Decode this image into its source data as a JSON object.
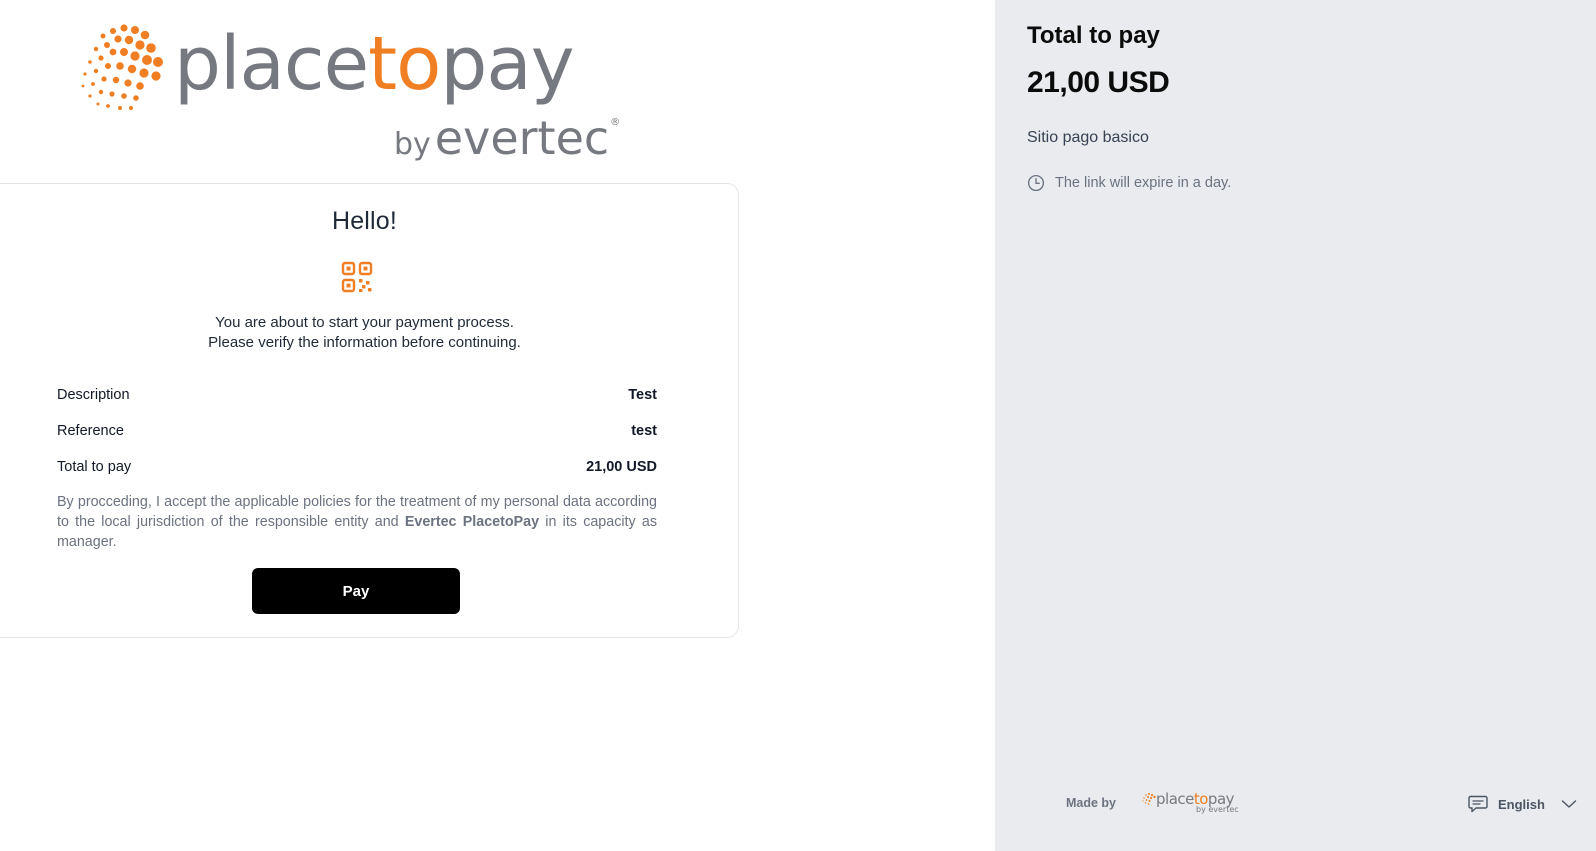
{
  "brand": {
    "word_main_1": "place",
    "word_main_2": "to",
    "word_main_3": "pay",
    "by": "by",
    "evertec": "evertec",
    "registered": "®",
    "primary_color": "#f07f23",
    "gray_color": "#767a80"
  },
  "card": {
    "title": "Hello!",
    "icon": "qr-code-icon",
    "intro_line1": "You are about to start your payment process.",
    "intro_line2": "Please verify the information before continuing.",
    "rows": [
      {
        "label": "Description",
        "value": "Test"
      },
      {
        "label": "Reference",
        "value": "test"
      },
      {
        "label": "Total to pay",
        "value": "21,00 USD"
      }
    ],
    "policy_before": "By procceding, I accept the applicable policies for the treatment of my personal data according to the local jurisdiction of the responsible entity and ",
    "policy_strong": "Evertec PlacetoPay",
    "policy_after": " in its capacity as manager.",
    "pay_label": "Pay"
  },
  "summary": {
    "title": "Total to pay",
    "amount": "21,00 USD",
    "site": "Sitio pago basico",
    "expire_icon": "clock-icon",
    "expire_text": "The link will expire in a day."
  },
  "footer": {
    "made_by": "Made by",
    "mini_logo_1": "place",
    "mini_logo_2": "to",
    "mini_logo_3": "pay",
    "mini_by": "by evertec",
    "lang_icon": "chat-icon",
    "language": "English",
    "chevron_icon": "chevron-down-icon"
  }
}
